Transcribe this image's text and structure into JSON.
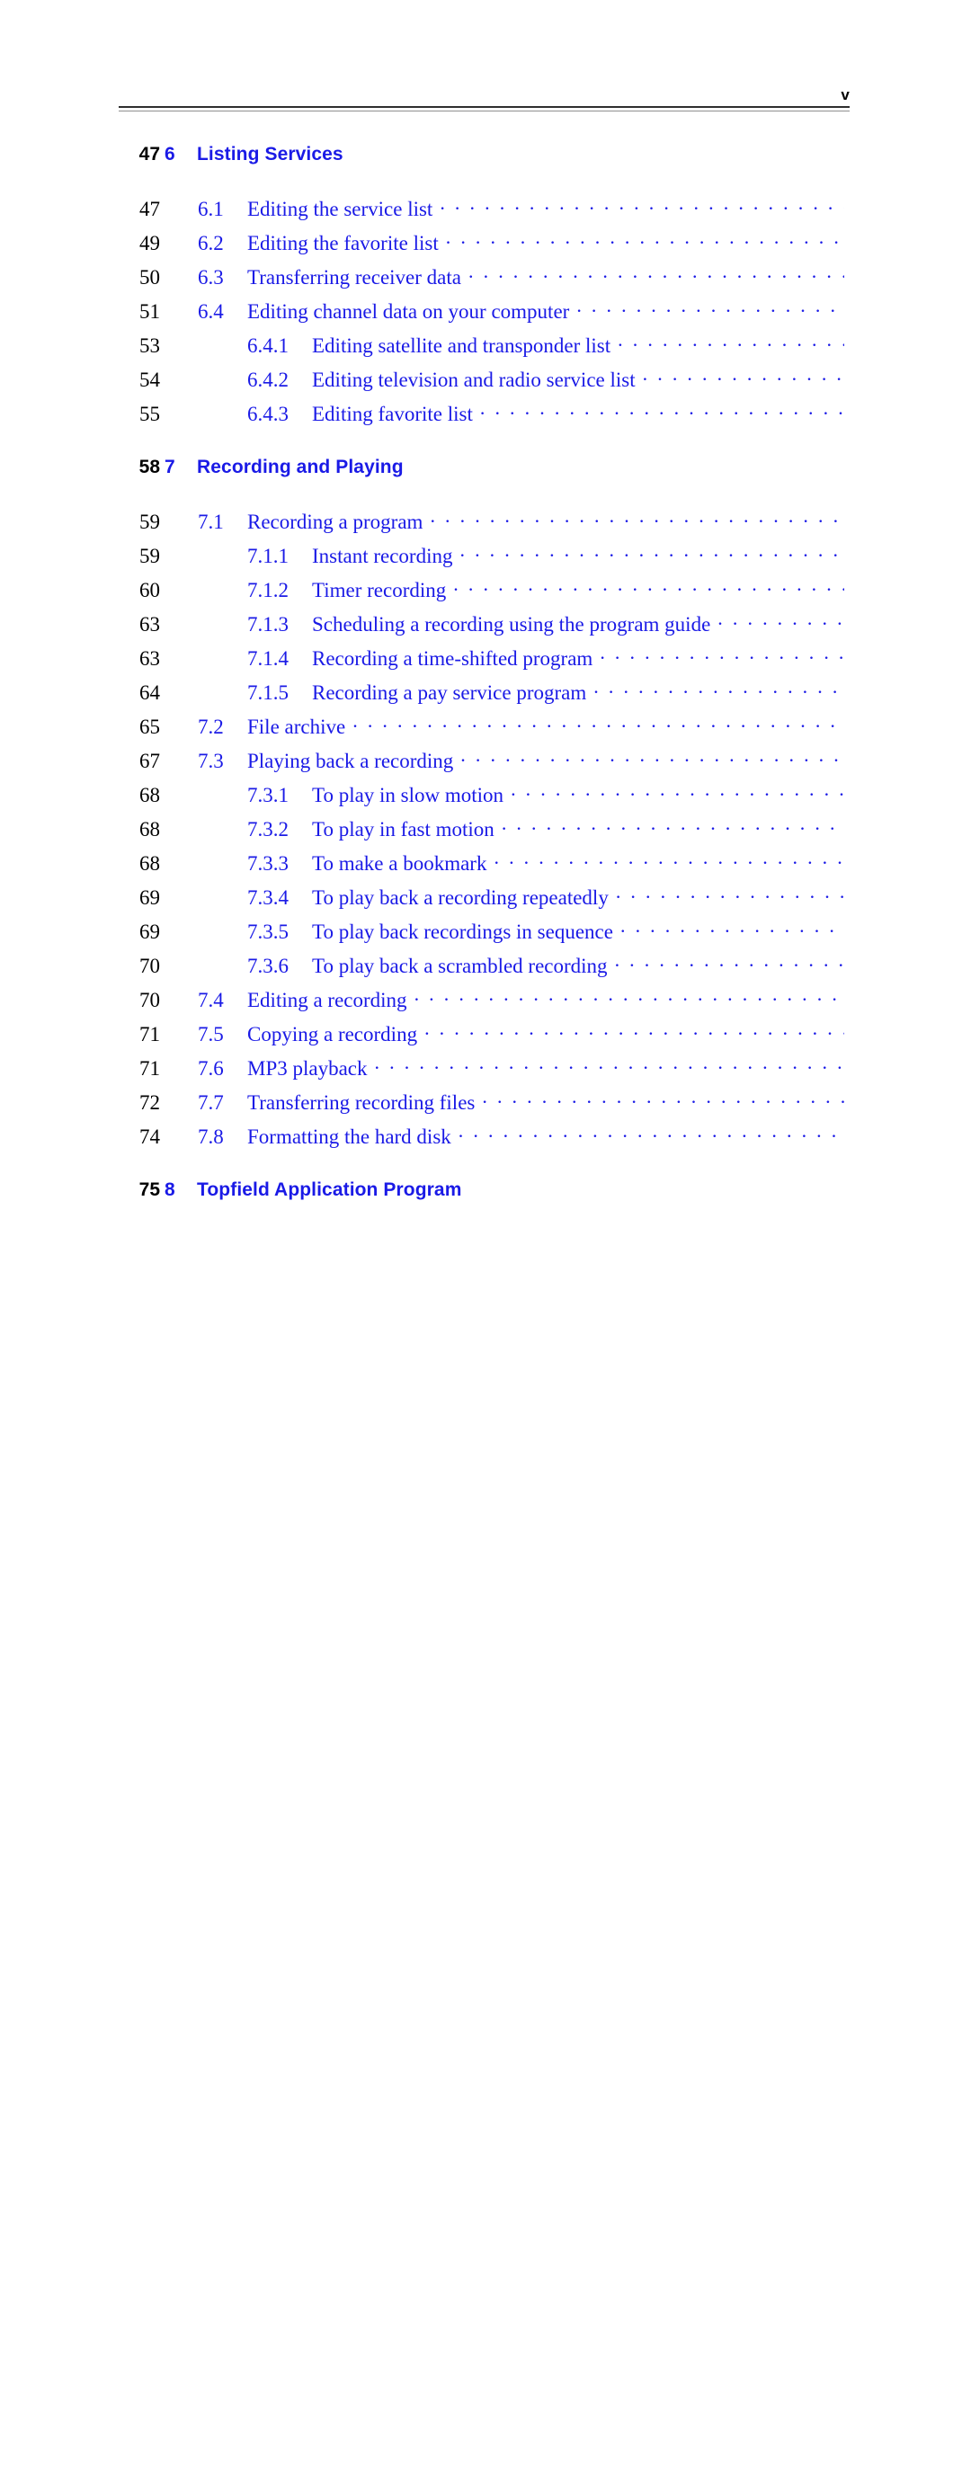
{
  "page": {
    "folio": "v",
    "background_color": "#ffffff",
    "link_color": "#1a1ae6",
    "page_number_color": "#000000",
    "rule_color": "#2f2f2f"
  },
  "toc": {
    "entries": [
      {
        "level": "chapter",
        "number": "6",
        "title": "Listing Services",
        "page": "47",
        "gap_before": false
      },
      {
        "level": "section",
        "number": "6.1",
        "title": "Editing the service list",
        "page": "47",
        "gap_before": false
      },
      {
        "level": "section",
        "number": "6.2",
        "title": "Editing the favorite list",
        "page": "49",
        "gap_before": false
      },
      {
        "level": "section",
        "number": "6.3",
        "title": "Transferring receiver data",
        "page": "50",
        "gap_before": false
      },
      {
        "level": "section",
        "number": "6.4",
        "title": "Editing channel data on your computer",
        "page": "51",
        "gap_before": false
      },
      {
        "level": "subsection",
        "number": "6.4.1",
        "title": "Editing satellite and transponder list",
        "page": "53",
        "gap_before": false
      },
      {
        "level": "subsection",
        "number": "6.4.2",
        "title": "Editing television and radio service list",
        "page": "54",
        "gap_before": false
      },
      {
        "level": "subsection",
        "number": "6.4.3",
        "title": "Editing favorite list",
        "page": "55",
        "gap_before": false
      },
      {
        "level": "chapter",
        "number": "7",
        "title": "Recording and Playing",
        "page": "58",
        "gap_before": true
      },
      {
        "level": "section",
        "number": "7.1",
        "title": "Recording a program",
        "page": "59",
        "gap_before": false
      },
      {
        "level": "subsection",
        "number": "7.1.1",
        "title": "Instant recording",
        "page": "59",
        "gap_before": false
      },
      {
        "level": "subsection",
        "number": "7.1.2",
        "title": "Timer recording",
        "page": "60",
        "gap_before": false
      },
      {
        "level": "subsection",
        "number": "7.1.3",
        "title": "Scheduling a recording using the program guide",
        "page": "63",
        "gap_before": false
      },
      {
        "level": "subsection",
        "number": "7.1.4",
        "title": "Recording a time-shifted program",
        "page": "63",
        "gap_before": false
      },
      {
        "level": "subsection",
        "number": "7.1.5",
        "title": "Recording a pay service program",
        "page": "64",
        "gap_before": false
      },
      {
        "level": "section",
        "number": "7.2",
        "title": "File archive",
        "page": "65",
        "gap_before": false
      },
      {
        "level": "section",
        "number": "7.3",
        "title": "Playing back a recording",
        "page": "67",
        "gap_before": false
      },
      {
        "level": "subsection",
        "number": "7.3.1",
        "title": "To play in slow motion",
        "page": "68",
        "gap_before": false
      },
      {
        "level": "subsection",
        "number": "7.3.2",
        "title": "To play in fast motion",
        "page": "68",
        "gap_before": false
      },
      {
        "level": "subsection",
        "number": "7.3.3",
        "title": "To make a bookmark",
        "page": "68",
        "gap_before": false
      },
      {
        "level": "subsection",
        "number": "7.3.4",
        "title": "To play back a recording repeatedly",
        "page": "69",
        "gap_before": false
      },
      {
        "level": "subsection",
        "number": "7.3.5",
        "title": "To play back recordings in sequence",
        "page": "69",
        "gap_before": false
      },
      {
        "level": "subsection",
        "number": "7.3.6",
        "title": "To play back a scrambled recording",
        "page": "70",
        "gap_before": false
      },
      {
        "level": "section",
        "number": "7.4",
        "title": "Editing a recording",
        "page": "70",
        "gap_before": false
      },
      {
        "level": "section",
        "number": "7.5",
        "title": "Copying a recording",
        "page": "71",
        "gap_before": false
      },
      {
        "level": "section",
        "number": "7.6",
        "title": "MP3 playback",
        "page": "71",
        "gap_before": false
      },
      {
        "level": "section",
        "number": "7.7",
        "title": "Transferring recording files",
        "page": "72",
        "gap_before": false
      },
      {
        "level": "section",
        "number": "7.8",
        "title": "Formatting the hard disk",
        "page": "74",
        "gap_before": false
      },
      {
        "level": "chapter",
        "number": "8",
        "title": "Topfield Application Program",
        "page": "75",
        "gap_before": true
      }
    ],
    "leader_character": "."
  }
}
